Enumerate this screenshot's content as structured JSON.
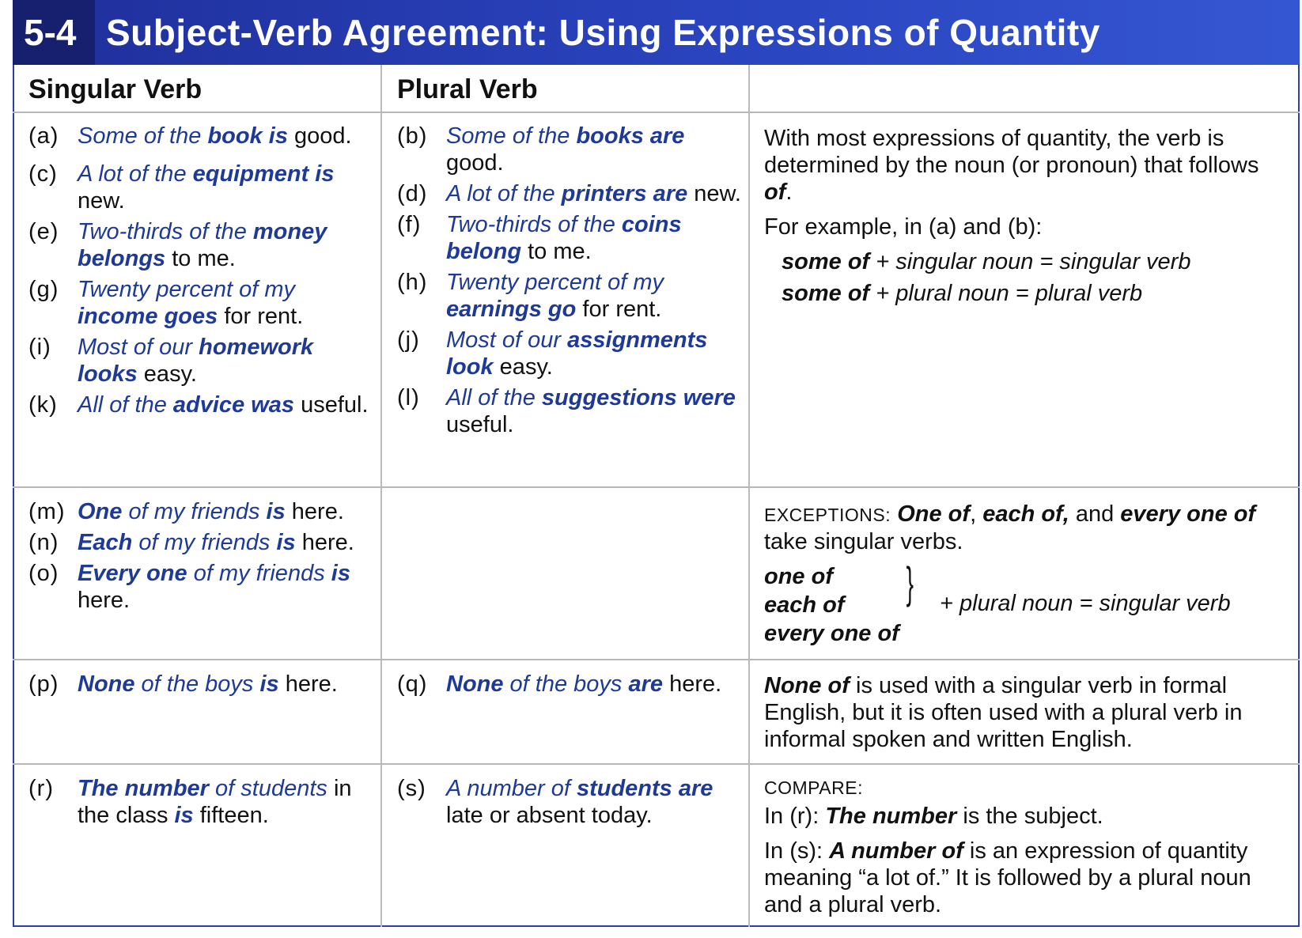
{
  "header": {
    "section_number": "5-4",
    "title": "Subject-Verb Agreement:  Using Expressions of Quantity"
  },
  "columns": {
    "singular": "Singular Verb",
    "plural": "Plural Verb"
  },
  "examples": {
    "a": {
      "label": "(a)",
      "p1": "Some of the ",
      "p2": "book is",
      "p3": " good."
    },
    "b": {
      "label": "(b)",
      "p1": "Some of the ",
      "p2": "books are",
      "p3": " good."
    },
    "c": {
      "label": "(c)",
      "p1": "A lot of the ",
      "p2": "equipment is",
      "p3": " new."
    },
    "d": {
      "label": "(d)",
      "p1": "A lot of the ",
      "p2": "printers are",
      "p3": " new."
    },
    "e": {
      "label": "(e)",
      "p1": "Two-thirds of the ",
      "p2": "money belongs",
      "p3": " to me."
    },
    "f": {
      "label": "(f)",
      "p1": "Two-thirds of the ",
      "p2": "coins belong",
      "p3": " to me."
    },
    "g": {
      "label": "(g)",
      "p1": "Twenty percent of my ",
      "p2": "income goes",
      "p3": " for rent."
    },
    "h": {
      "label": "(h)",
      "p1": "Twenty percent of my ",
      "p2": "earnings go",
      "p3": " for rent."
    },
    "i": {
      "label": "(i)",
      "p1": "Most of our ",
      "p2": "homework looks",
      "p3": " easy."
    },
    "j": {
      "label": "(j)",
      "p1": "Most of our ",
      "p2": "assignments look",
      "p3": " easy."
    },
    "k": {
      "label": "(k)",
      "p1": "All of the ",
      "p2": "advice was",
      "p3": " useful."
    },
    "l": {
      "label": "(l)",
      "p1": "All of the ",
      "p2": "suggestions were",
      "p3": " useful."
    },
    "m": {
      "label": "(m)",
      "p1": "One",
      "p2": " of my friends ",
      "p3": "is",
      "p4": " here."
    },
    "n": {
      "label": "(n)",
      "p1": "Each",
      "p2": " of my friends ",
      "p3": "is",
      "p4": " here."
    },
    "o": {
      "label": "(o)",
      "p1": "Every one",
      "p2": " of my friends ",
      "p3": "is",
      "p4": " here."
    },
    "p": {
      "label": "(p)",
      "p1": "None",
      "p2": " of the boys ",
      "p3": "is",
      "p4": " here."
    },
    "q": {
      "label": "(q)",
      "p1": "None",
      "p2": " of the boys ",
      "p3": "are",
      "p4": " here."
    },
    "r": {
      "label": "(r)",
      "p1": "The number",
      "p2": " of students",
      "p3": " in the class ",
      "p4": "is",
      "p5": " fifteen."
    },
    "s": {
      "label": "(s)",
      "p1": "A number of ",
      "p2": "students are",
      "p3": " late or absent today."
    }
  },
  "explanations": {
    "row1": {
      "t1": "With most expressions of quantity, the verb is determined by the noun (or pronoun) that follows ",
      "t1b": "of",
      "t1c": ".",
      "t2": "For example, in (a) and (b):",
      "f1a": "some of",
      "f1b": " + singular noun = singular verb",
      "f2a": "some of",
      "f2b": " + plural noun = plural verb"
    },
    "row2": {
      "sc": "EXCEPTIONS:",
      "b1": "One of",
      "s1": ", ",
      "b2": "each of,",
      "s2": " and ",
      "b3": "every one of",
      "t": " take singular verbs.",
      "list1": "one of",
      "list2": "each of",
      "list3": "every one of",
      "brace": "}",
      "rule": "+ plural noun = singular verb"
    },
    "row3": {
      "b": "None of",
      "t": " is used with a singular verb in formal English, but it is often used with a plural verb in informal spoken and written English."
    },
    "row4": {
      "sc": "COMPARE:",
      "r_lbl": "In (r):  ",
      "r_b": "The number",
      "r_t": " is the subject.",
      "s_lbl": "In (s):  ",
      "s_b": "A number of",
      "s_t": " is an expression of quantity meaning “a lot of.”  It is followed by a plural noun and a plural verb."
    }
  }
}
